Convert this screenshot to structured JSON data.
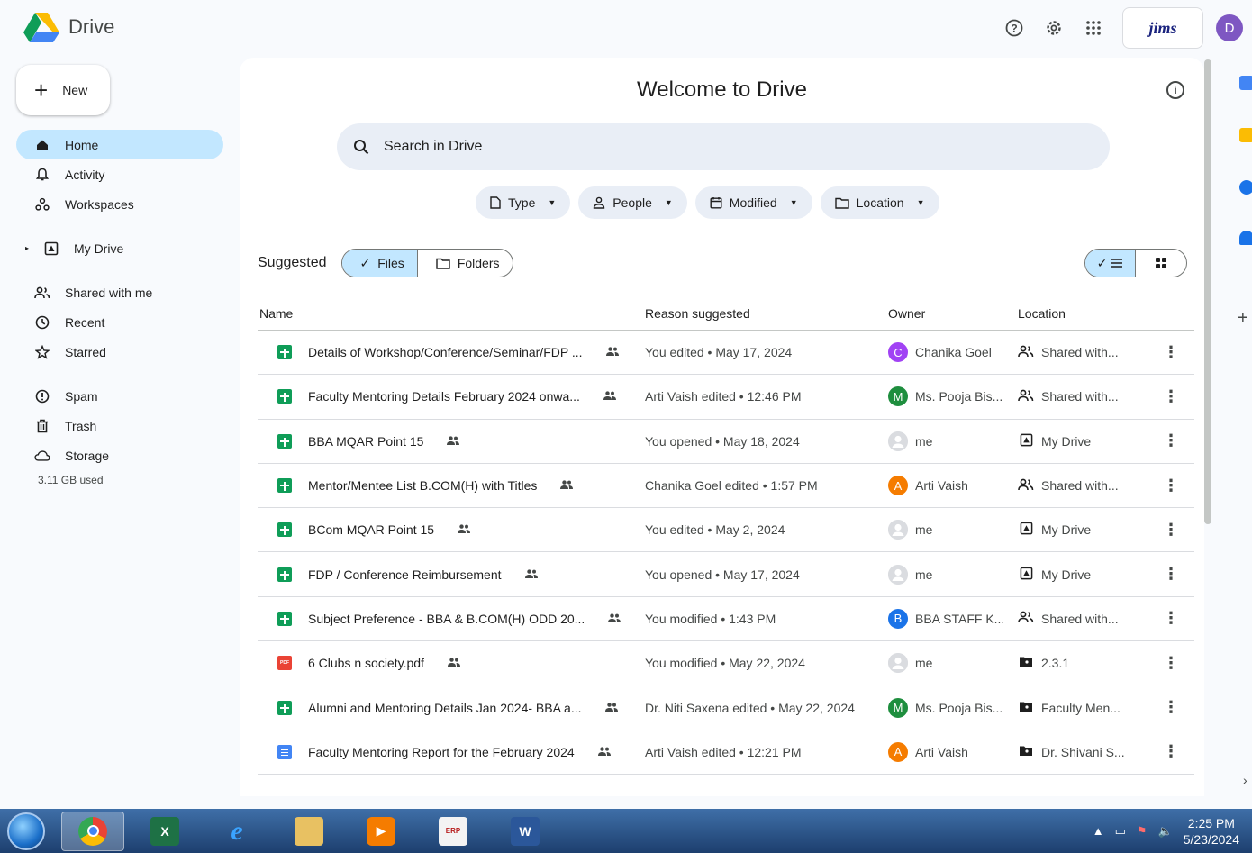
{
  "app": {
    "name": "Drive"
  },
  "topbar": {
    "org_label": "jims",
    "avatar_letter": "D"
  },
  "sidebar": {
    "new_label": "New",
    "items": [
      {
        "label": "Home",
        "icon": "home-icon",
        "active": true
      },
      {
        "label": "Activity",
        "icon": "bell-icon"
      },
      {
        "label": "Workspaces",
        "icon": "workspaces-icon"
      },
      {
        "label": "My Drive",
        "icon": "my-drive-icon"
      },
      {
        "label": "Shared with me",
        "icon": "people-icon"
      },
      {
        "label": "Recent",
        "icon": "clock-icon"
      },
      {
        "label": "Starred",
        "icon": "star-icon"
      },
      {
        "label": "Spam",
        "icon": "spam-icon"
      },
      {
        "label": "Trash",
        "icon": "trash-icon"
      },
      {
        "label": "Storage",
        "icon": "cloud-icon"
      }
    ],
    "storage_used": "3.11 GB used"
  },
  "main": {
    "title": "Welcome to Drive",
    "search_placeholder": "Search in Drive",
    "filters": [
      "Type",
      "People",
      "Modified",
      "Location"
    ],
    "suggested_label": "Suggested",
    "segment": {
      "files": "Files",
      "folders": "Folders"
    },
    "columns": {
      "name": "Name",
      "reason": "Reason suggested",
      "owner": "Owner",
      "location": "Location"
    },
    "rows": [
      {
        "type": "sheet",
        "name": "Details of Workshop/Conference/Seminar/FDP ...",
        "reason": "You edited • May 17, 2024",
        "owner": "Chanika Goel",
        "owner_initial": "C",
        "owner_color": "#a142f4",
        "location": "Shared with...",
        "loc_icon": "shared"
      },
      {
        "type": "sheet",
        "name": "Faculty Mentoring Details February 2024 onwa...",
        "reason": "Arti Vaish edited • 12:46 PM",
        "owner": "Ms. Pooja Bis...",
        "owner_initial": "M",
        "owner_color": "#1e8e3e",
        "location": "Shared with...",
        "loc_icon": "shared"
      },
      {
        "type": "sheet",
        "name": "BBA MQAR Point 15",
        "reason": "You opened • May 18, 2024",
        "owner": "me",
        "owner_initial": "",
        "owner_color": "me",
        "location": "My Drive",
        "loc_icon": "drive"
      },
      {
        "type": "sheet",
        "name": "Mentor/Mentee List B.COM(H) with Titles",
        "reason": "Chanika Goel edited • 1:57 PM",
        "owner": "Arti Vaish",
        "owner_initial": "A",
        "owner_color": "#f57c00",
        "location": "Shared with...",
        "loc_icon": "shared"
      },
      {
        "type": "sheet",
        "name": "BCom MQAR Point 15",
        "reason": "You edited • May 2, 2024",
        "owner": "me",
        "owner_initial": "",
        "owner_color": "me",
        "location": "My Drive",
        "loc_icon": "drive"
      },
      {
        "type": "sheet",
        "name": "FDP / Conference Reimbursement",
        "reason": "You opened • May 17, 2024",
        "owner": "me",
        "owner_initial": "",
        "owner_color": "me",
        "location": "My Drive",
        "loc_icon": "drive"
      },
      {
        "type": "sheet",
        "name": "Subject Preference - BBA & B.COM(H) ODD 20...",
        "reason": "You modified • 1:43 PM",
        "owner": "BBA STAFF K...",
        "owner_initial": "B",
        "owner_color": "#1a73e8",
        "location": "Shared with...",
        "loc_icon": "shared"
      },
      {
        "type": "pdf",
        "name": "6 Clubs n society.pdf",
        "reason": "You modified • May 22, 2024",
        "owner": "me",
        "owner_initial": "",
        "owner_color": "me",
        "location": "2.3.1",
        "loc_icon": "folder"
      },
      {
        "type": "sheet",
        "name": "Alumni and Mentoring Details Jan 2024- BBA a...",
        "reason": "Dr. Niti Saxena edited • May 22, 2024",
        "owner": "Ms. Pooja Bis...",
        "owner_initial": "M",
        "owner_color": "#1e8e3e",
        "location": "Faculty Men...",
        "loc_icon": "folder"
      },
      {
        "type": "doc",
        "name": "Faculty Mentoring Report for the February 2024",
        "reason": "Arti Vaish edited • 12:21 PM",
        "owner": "Arti Vaish",
        "owner_initial": "A",
        "owner_color": "#f57c00",
        "location": "Dr. Shivani S...",
        "loc_icon": "folder"
      }
    ]
  },
  "taskbar": {
    "time": "2:25 PM",
    "date": "5/23/2024"
  }
}
